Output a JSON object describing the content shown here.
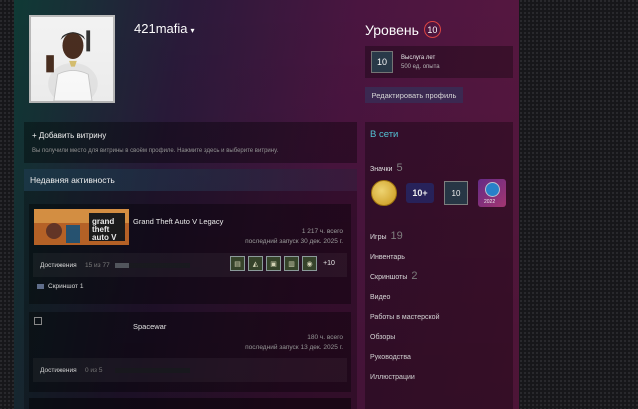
{
  "profile": {
    "username": "421mafia",
    "caret": "▾",
    "level_heading": "Уровень",
    "level": "10",
    "badge_box": {
      "icon_text": "10",
      "title": "Выслуга лет",
      "xp": "500 ед. опыта"
    },
    "edit_button": "Редактировать профиль"
  },
  "showcase": {
    "title": "+ Добавить витрину",
    "desc": "Вы получили место для витрины в своём профиле. Нажмите здесь и выберите витрину."
  },
  "activity": {
    "header": "Недавняя активность",
    "games": [
      {
        "name": "Grand Theft Auto V Legacy",
        "hours": "1 217 ч. всего",
        "last": "последний запуск 30 дек. 2025 г.",
        "ach_label": "Достижения",
        "ach_count": "15 из 77",
        "progress": 0.19,
        "more": "+10",
        "screenshot": "Скриншот 1"
      },
      {
        "name": "Spacewar",
        "hours": "180 ч. всего",
        "last": "последний запуск 13 дек. 2025 г.",
        "ach_label": "Достижения",
        "ach_count": "0 из 5",
        "progress": 0
      }
    ]
  },
  "sidebar": {
    "online": "В сети",
    "badges_label": "Значки",
    "badges_count": "5",
    "badge_10plus": "10+",
    "badge_10": "10",
    "badge_year": "2022",
    "games_label": "Игры",
    "games_count": "19",
    "inventory": "Инвентарь",
    "screenshots_label": "Скриншоты",
    "screenshots_count": "2",
    "video": "Видео",
    "workshop": "Работы в мастерской",
    "reviews": "Обзоры",
    "guides": "Руководства",
    "artwork": "Иллюстрации"
  },
  "colors": {
    "online": "#57cbde",
    "level_ring": "#dd4444"
  }
}
